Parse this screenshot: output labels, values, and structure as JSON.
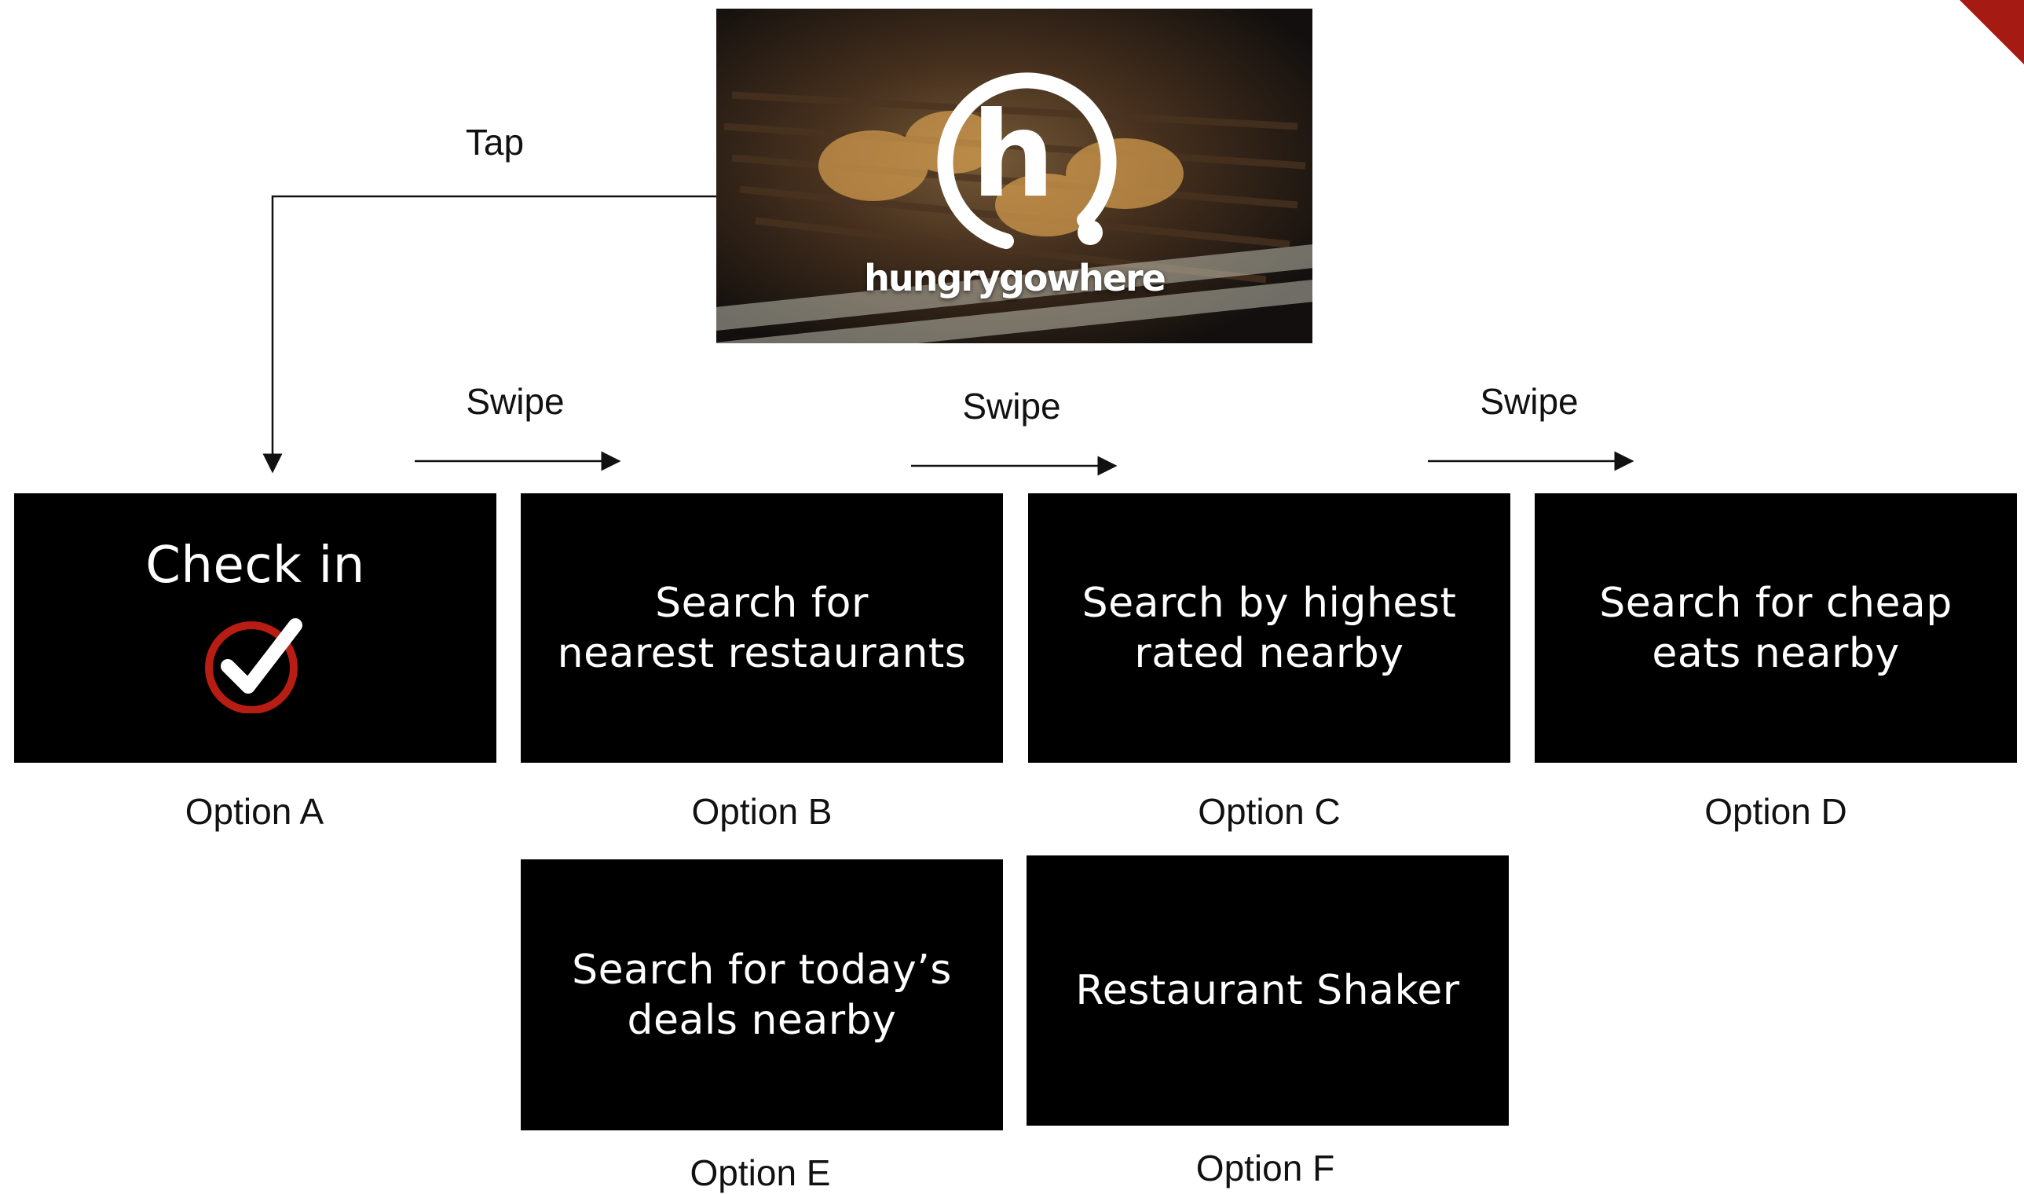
{
  "brand": {
    "name": "hungrygowhere",
    "logo_letter": "h",
    "accent_color": "#a61a14"
  },
  "arrows": {
    "tap": "Tap",
    "swipe_1": "Swipe",
    "swipe_2": "Swipe",
    "swipe_3": "Swipe"
  },
  "options": [
    {
      "label": "Option A",
      "card_text": "Check in",
      "icon": "check-circle-icon"
    },
    {
      "label": "Option B",
      "card_text": "Search for\nnearest restaurants"
    },
    {
      "label": "Option C",
      "card_text": "Search by highest\nrated nearby"
    },
    {
      "label": "Option D",
      "card_text": "Search for cheap\neats nearby"
    },
    {
      "label": "Option E",
      "card_text": "Search for today’s\ndeals nearby"
    },
    {
      "label": "Option F",
      "card_text": "Restaurant Shaker"
    }
  ]
}
